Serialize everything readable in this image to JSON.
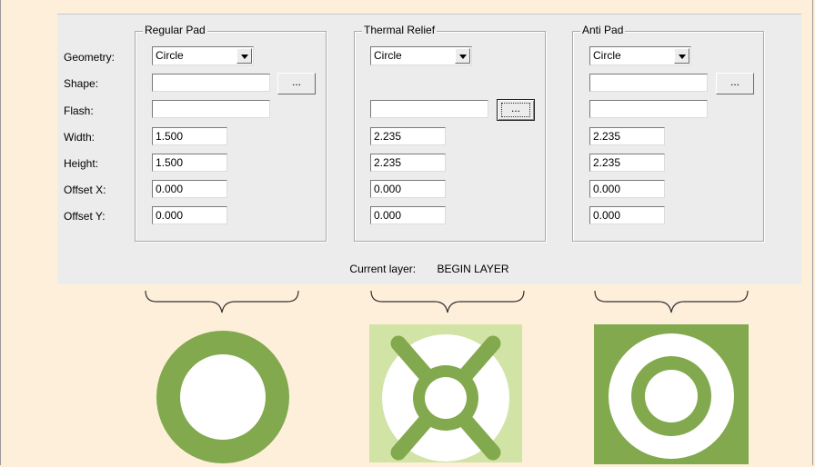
{
  "labels": {
    "geometry": "Geometry:",
    "shape": "Shape:",
    "flash": "Flash:",
    "width": "Width:",
    "height": "Height:",
    "offset_x": "Offset X:",
    "offset_y": "Offset Y:"
  },
  "groups": {
    "regular": {
      "title": "Regular Pad",
      "geometry": "Circle",
      "shape": "",
      "flash": "",
      "width": "1.500",
      "height": "1.500",
      "offset_x": "0.000",
      "offset_y": "0.000",
      "browse": "..."
    },
    "thermal": {
      "title": "Thermal Relief",
      "geometry": "Circle",
      "flash": "",
      "width": "2.235",
      "height": "2.235",
      "offset_x": "0.000",
      "offset_y": "0.000",
      "browse": "..."
    },
    "anti": {
      "title": "Anti Pad",
      "geometry": "Circle",
      "shape": "",
      "flash": "",
      "width": "2.235",
      "height": "2.235",
      "offset_x": "0.000",
      "offset_y": "0.000",
      "browse": "..."
    }
  },
  "current_layer": {
    "label": "Current layer:",
    "value": "BEGIN LAYER"
  },
  "colors": {
    "pad_green": "#82a94e",
    "light_green": "#d2e3a6",
    "background": "#fdefd9",
    "dialog": "#ececec"
  }
}
